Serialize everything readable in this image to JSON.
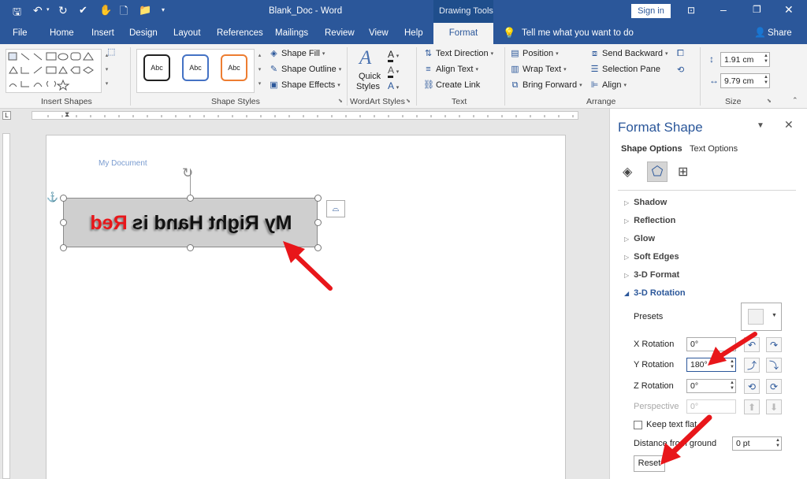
{
  "title_bar": {
    "doc_title": "Blank_Doc - Word",
    "tools_label": "Drawing Tools",
    "signin": "Sign in"
  },
  "tabs": [
    "File",
    "Home",
    "Insert",
    "Design",
    "Layout",
    "References",
    "Mailings",
    "Review",
    "View",
    "Help",
    "Format"
  ],
  "tell_me": "Tell me what you want to do",
  "share": "Share",
  "ribbon": {
    "insert_shapes": "Insert Shapes",
    "shape_styles": "Shape Styles",
    "style_abc": "Abc",
    "shape_fill": "Shape Fill",
    "shape_outline": "Shape Outline",
    "shape_effects": "Shape Effects",
    "quick_styles_1": "Quick",
    "quick_styles_2": "Styles",
    "wordart_styles": "WordArt Styles",
    "text_direction": "Text Direction",
    "align_text": "Align Text",
    "create_link": "Create Link",
    "text_group": "Text",
    "position": "Position",
    "wrap_text": "Wrap Text",
    "bring_forward": "Bring Forward",
    "send_backward": "Send Backward",
    "selection_pane": "Selection Pane",
    "align": "Align",
    "arrange": "Arrange",
    "height": "1.91 cm",
    "width": "9.79 cm",
    "size": "Size"
  },
  "document": {
    "header_text": "My Document",
    "shape_text": "My Right Hand is",
    "shape_text_red": "Red"
  },
  "pane": {
    "title": "Format Shape",
    "tab_shape": "Shape Options",
    "tab_text": "Text Options",
    "sections": [
      "Shadow",
      "Reflection",
      "Glow",
      "Soft Edges",
      "3-D Format",
      "3-D Rotation"
    ],
    "presets": "Presets",
    "x_rotation": "X Rotation",
    "x_value": "0°",
    "y_rotation": "Y Rotation",
    "y_value": "180°",
    "z_rotation": "Z Rotation",
    "z_value": "0°",
    "perspective": "Perspective",
    "perspective_value": "0°",
    "keep_text_flat": "Keep text flat",
    "distance_label": "Distance from ground",
    "distance_value": "0 pt",
    "reset": "Reset"
  },
  "colors": {
    "accent": "#2b579a",
    "arrow": "#e8161a",
    "shape_fill": "#cfcfcf"
  }
}
